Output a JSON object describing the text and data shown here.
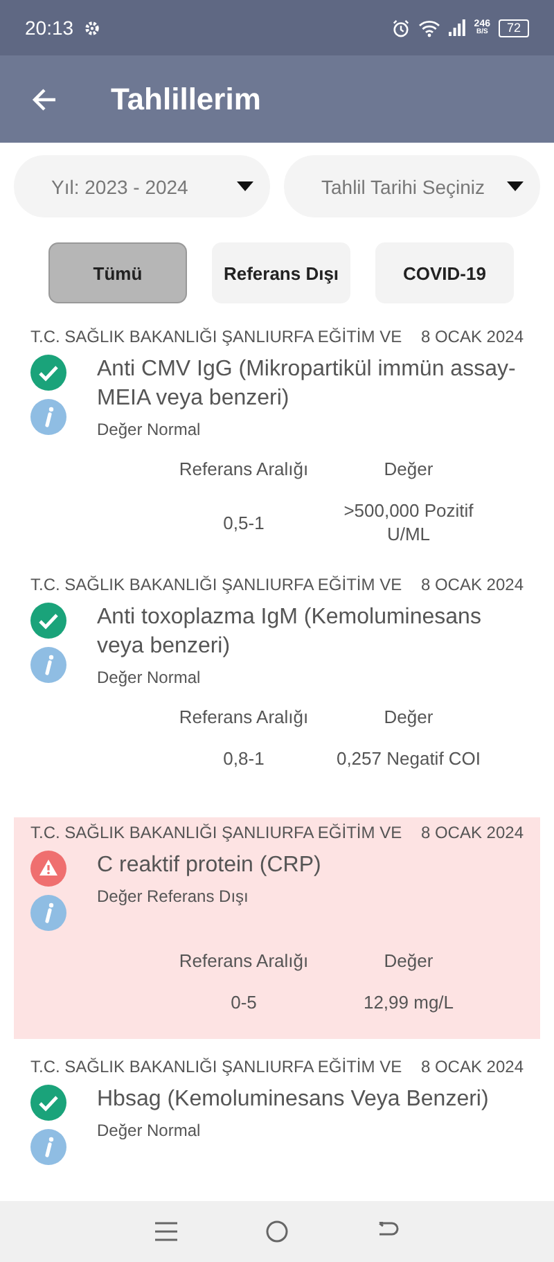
{
  "status_bar": {
    "time": "20:13",
    "speed": "246",
    "speed_unit": "B/S",
    "battery": "72"
  },
  "app_bar": {
    "title": "Tahlillerim"
  },
  "filters": [
    {
      "label": "Yıl: 2023 - 2024"
    },
    {
      "label": "Tahlil Tarihi Seçiniz"
    }
  ],
  "tabs": [
    {
      "label": "Tümü",
      "selected": true
    },
    {
      "label": "Referans Dışı",
      "selected": false
    },
    {
      "label": "COVID-19",
      "selected": false
    }
  ],
  "results": [
    {
      "hospital": "T.C. SAĞLIK BAKANLIĞI ŞANLIURFA EĞİTİM VE",
      "date": "8 OCAK 2024",
      "name": "Anti CMV IgG (Mikropartikül immün assay-MEIA veya benzeri)",
      "kind": "normal",
      "status": "Değer Normal",
      "range_label": "Referans Aralığı",
      "value_label": "Değer",
      "range": "0,5-1",
      "value": ">500,000 Pozitif U/ML"
    },
    {
      "hospital": "T.C. SAĞLIK BAKANLIĞI ŞANLIURFA EĞİTİM VE",
      "date": "8 OCAK 2024",
      "name": "Anti toxoplazma IgM (Kemoluminesans veya benzeri)",
      "kind": "normal",
      "status": "Değer Normal",
      "range_label": "Referans Aralığı",
      "value_label": "Değer",
      "range": "0,8-1",
      "value": "0,257 Negatif COI"
    },
    {
      "hospital": "T.C. SAĞLIK BAKANLIĞI ŞANLIURFA EĞİTİM VE",
      "date": "8 OCAK 2024",
      "name": "C reaktif protein (CRP)",
      "kind": "abnormal",
      "status": "Değer Referans Dışı",
      "range_label": "Referans Aralığı",
      "value_label": "Değer",
      "range": "0-5",
      "value": "12,99 mg/L"
    },
    {
      "hospital": "T.C. SAĞLIK BAKANLIĞI ŞANLIURFA EĞİTİM VE",
      "date": "8 OCAK 2024",
      "name": "Hbsag (Kemoluminesans Veya Benzeri)",
      "kind": "normal",
      "status": "Değer Normal"
    }
  ]
}
